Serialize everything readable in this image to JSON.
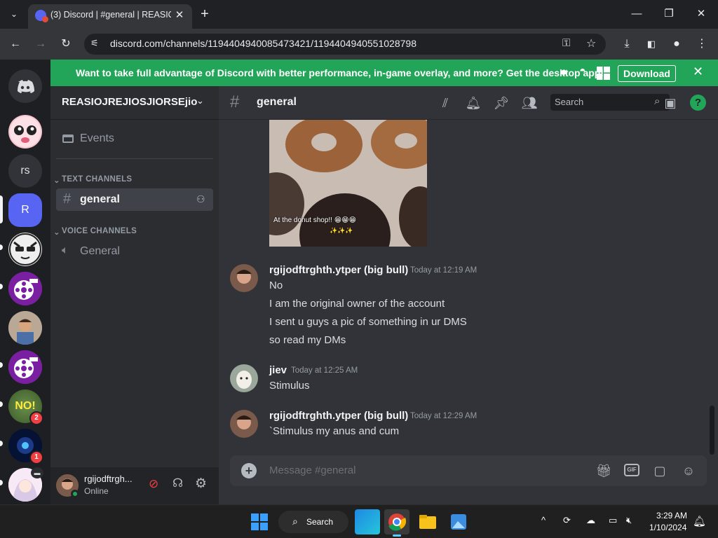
{
  "browser": {
    "tab_title": "(3) Discord | #general | REASIOJREJIOSJIORSEjio",
    "tab_close": "✕",
    "new_tab": "+",
    "url": "discord.com/channels/1194404940085473421/1194404940551028798",
    "window_controls": {
      "minimize": "—",
      "restore": "❐",
      "close": "✕"
    }
  },
  "banner": {
    "text": "Want to take full advantage of Discord with better performance, in-game overlay, and more? Get the desktop app!",
    "download_label": "Download",
    "close": "✕",
    "color": "#23a559"
  },
  "guilds": [
    {
      "name": "discord-home",
      "text": ""
    },
    {
      "name": "server-anime-face",
      "text": ""
    },
    {
      "name": "server-rs",
      "text": "rs"
    },
    {
      "name": "server-r",
      "text": "R"
    },
    {
      "name": "server-cat-sunglasses",
      "text": ""
    },
    {
      "name": "server-film-1",
      "text": ""
    },
    {
      "name": "server-photo-kid",
      "text": ""
    },
    {
      "name": "server-film-2",
      "text": ""
    },
    {
      "name": "server-no",
      "text": "NO!",
      "badge": "2"
    },
    {
      "name": "server-space",
      "text": "",
      "badge": "1"
    },
    {
      "name": "server-anime-girl",
      "text": ""
    }
  ],
  "server": {
    "name": "REASIOJREJIOSJIORSEjio",
    "events_label": "Events",
    "text_category": "TEXT CHANNELS",
    "voice_category": "VOICE CHANNELS",
    "text_channels": [
      {
        "name": "general",
        "active": true
      }
    ],
    "voice_channels": [
      {
        "name": "General"
      }
    ]
  },
  "user": {
    "name": "rgijodftrgh...",
    "status": "Online"
  },
  "channel": {
    "hash": "#",
    "name": "general",
    "search_placeholder": "Search"
  },
  "image_caption": {
    "line1": "At the donut shop!! 😁😁😁",
    "line2": "✨✨✨"
  },
  "messages": [
    {
      "author": "rgijodftrghth.ytper (big bull)",
      "time": "Today at 12:19 AM",
      "lines": [
        "No",
        "I am the original owner of the account",
        "I sent u guys a pic of something in ur DMS",
        "so read my DMs"
      ]
    },
    {
      "author": "jiev",
      "time": "Today at 12:25 AM",
      "lines": [
        "Stimulus"
      ]
    },
    {
      "author": "rgijodftrghth.ytper (big bull)",
      "time": "Today at 12:29 AM",
      "lines": [
        "`Stimulus my anus and cum"
      ]
    }
  ],
  "composer": {
    "placeholder": "Message #general",
    "gif_label": "GIF"
  },
  "taskbar": {
    "search_label": "Search",
    "time": "3:29 AM",
    "date": "1/10/2024"
  }
}
